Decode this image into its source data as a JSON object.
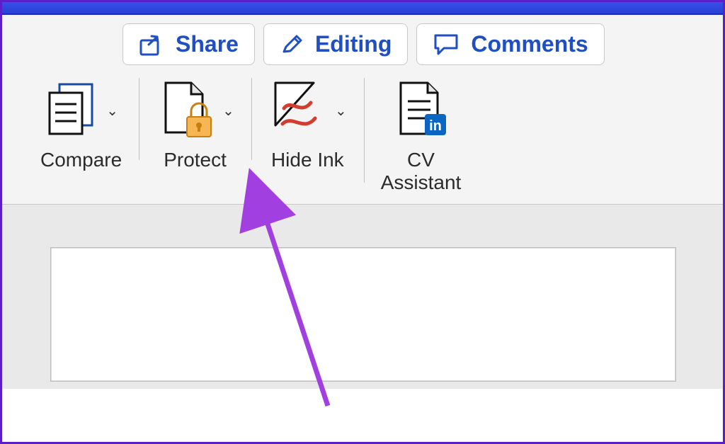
{
  "colors": {
    "accent": "#1f4fc2",
    "frame": "#5a1fc9",
    "annotation": "#a23fe0",
    "protect_lock": "#f3a23b",
    "ink": "#d33d2f",
    "linkedin": "#0a66c2"
  },
  "top_buttons": {
    "share": {
      "label": "Share"
    },
    "editing": {
      "label": "Editing"
    },
    "comments": {
      "label": "Comments"
    }
  },
  "ribbon": {
    "compare": {
      "label": "Compare"
    },
    "protect": {
      "label": "Protect"
    },
    "hide_ink": {
      "label": "Hide Ink"
    },
    "cv_assistant": {
      "label_line1": "CV",
      "label_line2": "Assistant"
    }
  }
}
